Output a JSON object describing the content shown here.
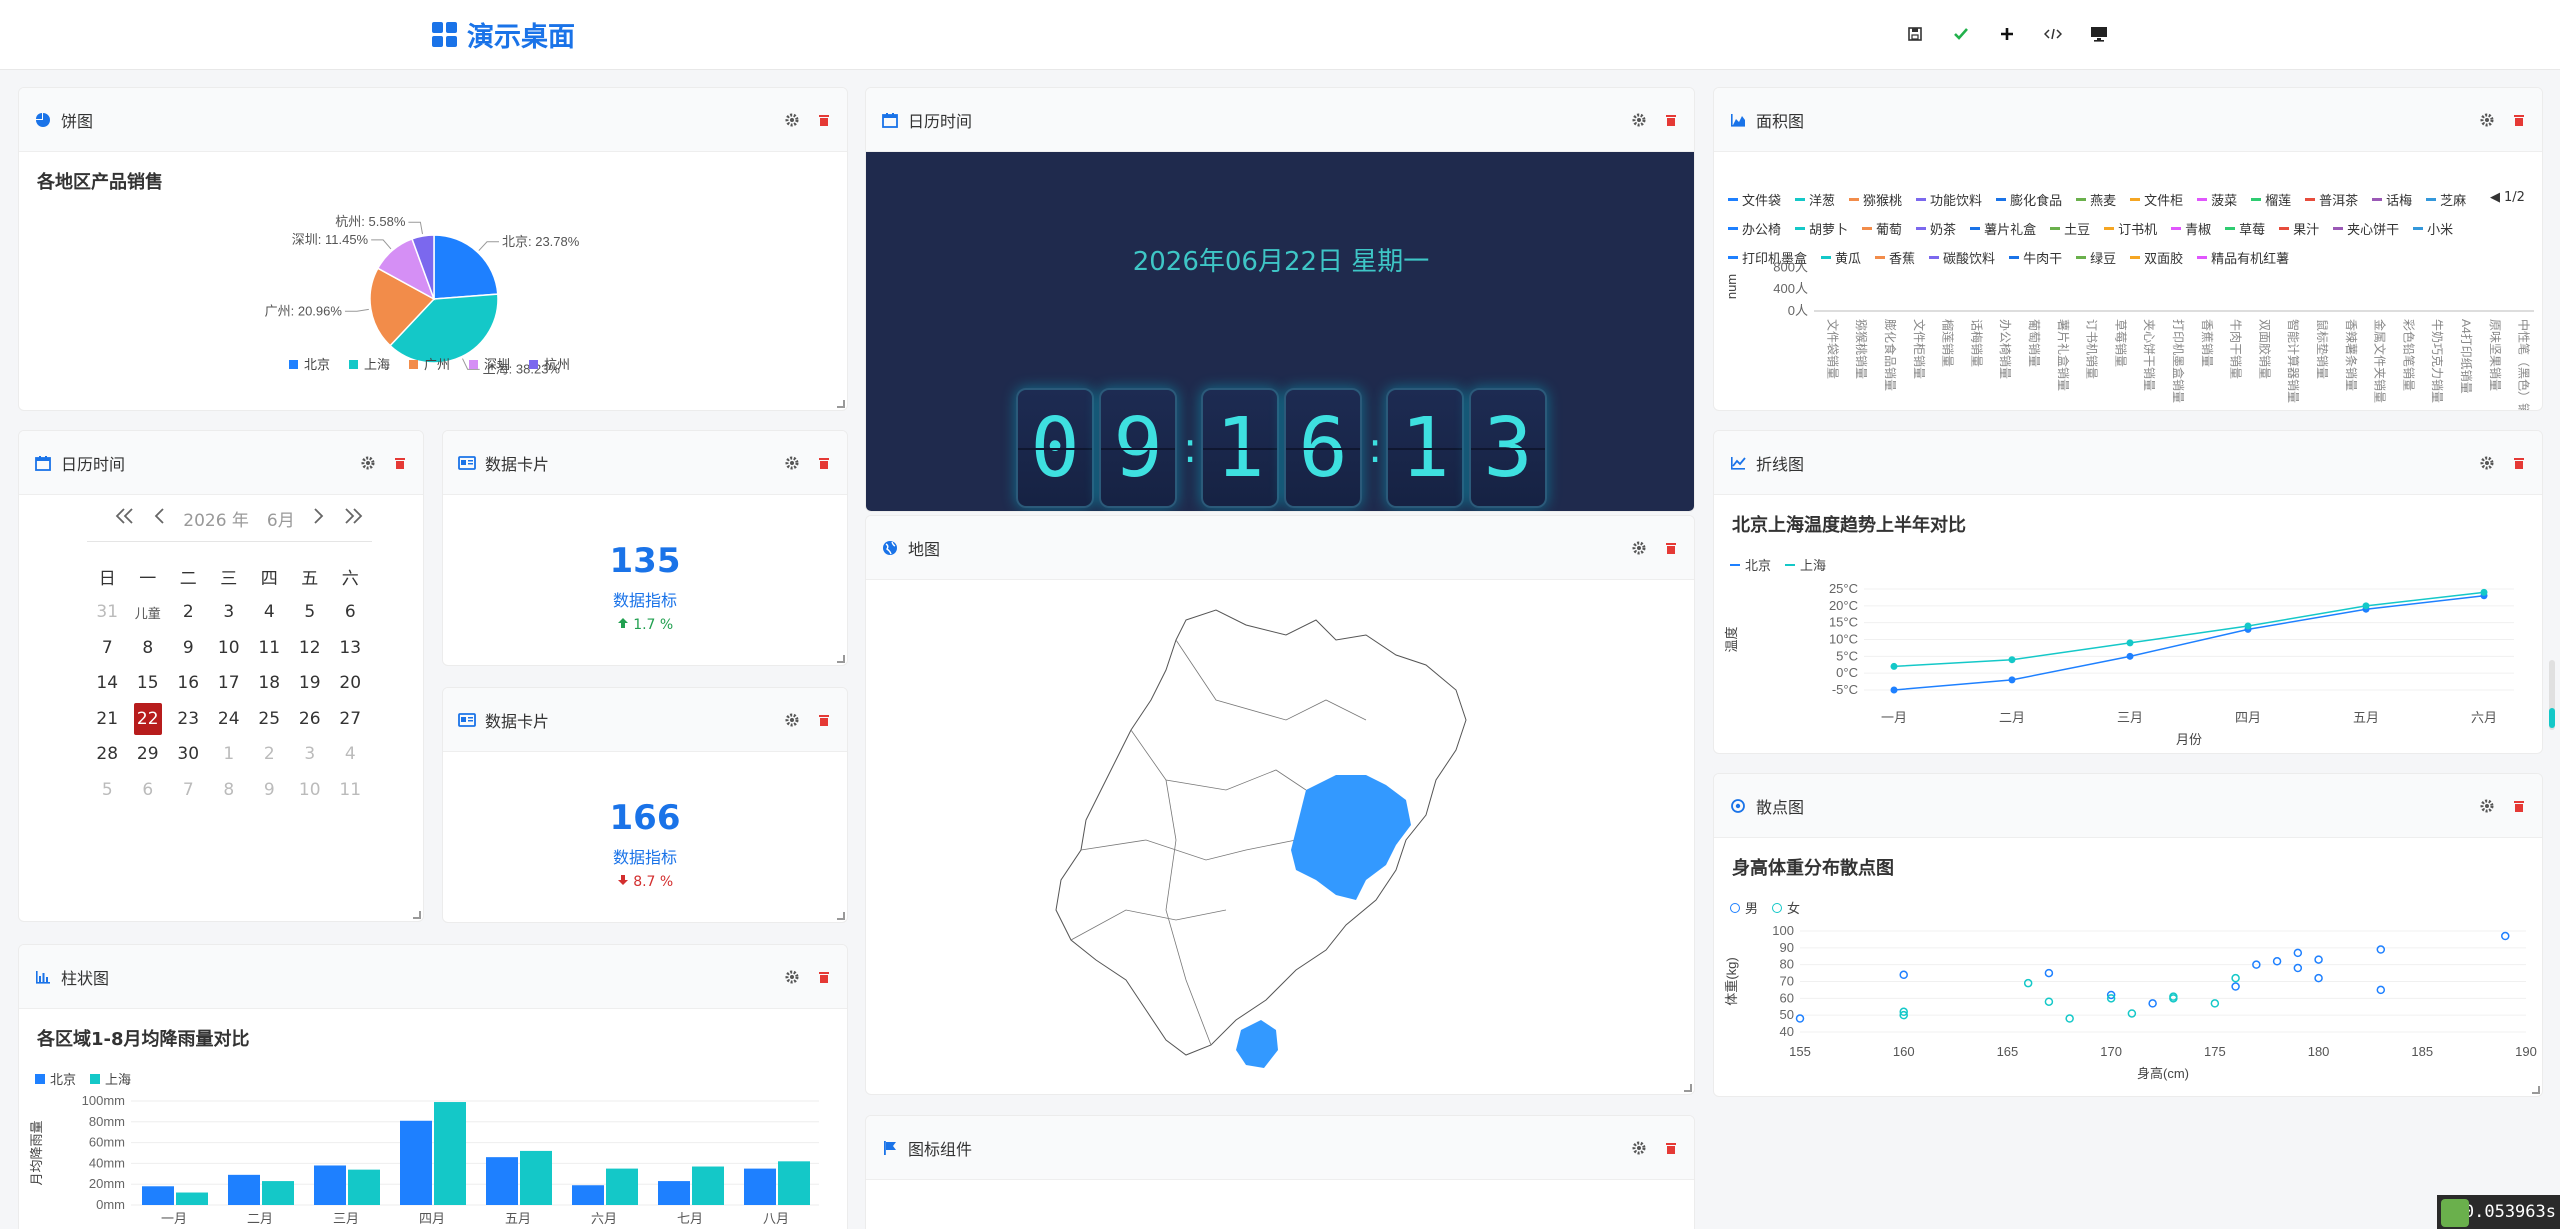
{
  "app": {
    "title": "演示桌面"
  },
  "toolbar": [
    "save-icon",
    "check-icon",
    "plus-icon",
    "code-icon",
    "monitor-icon"
  ],
  "colors": {
    "blue": "#1e80ff",
    "cyan": "#14c8c8",
    "orange": "#f28c4a",
    "purple": "#d58ff5",
    "violet": "#7b68ee",
    "accent": "#1a73e8"
  },
  "pie": {
    "panel_title": "饼图",
    "chart_data": {
      "type": "pie",
      "title": "各地区产品销售",
      "slices": [
        {
          "name": "北京",
          "value": 23.78,
          "label": "北京: 23.78%"
        },
        {
          "name": "上海",
          "value": 38.23,
          "label": "上海: 38.23%"
        },
        {
          "name": "广州",
          "value": 20.96,
          "label": "广州: 20.96%"
        },
        {
          "name": "深圳",
          "value": 11.45,
          "label": "深圳: 11.45%"
        },
        {
          "name": "杭州",
          "value": 5.58,
          "label": "杭州: 5.58%"
        }
      ],
      "legend": [
        "北京",
        "上海",
        "广州",
        "深圳",
        "杭州"
      ],
      "legend_position": "bottom"
    }
  },
  "calendar": {
    "panel_title": "日历时间",
    "year": "2026 年",
    "month": "6月",
    "weekdays": [
      "日",
      "一",
      "二",
      "三",
      "四",
      "五",
      "六"
    ],
    "days": [
      "31",
      "儿童",
      "2",
      "3",
      "4",
      "5",
      "6",
      "7",
      "8",
      "9",
      "10",
      "11",
      "12",
      "13",
      "14",
      "15",
      "16",
      "17",
      "18",
      "19",
      "20",
      "21",
      "22",
      "23",
      "24",
      "25",
      "26",
      "27",
      "28",
      "29",
      "30",
      "1",
      "2",
      "3",
      "4",
      "5",
      "6",
      "7",
      "8",
      "9",
      "10",
      "11"
    ],
    "selected_index": 22
  },
  "stat1": {
    "panel_title": "数据卡片",
    "value": "135",
    "label": "数据指标",
    "change": "1.7 %",
    "direction": "up"
  },
  "stat2": {
    "panel_title": "数据卡片",
    "value": "166",
    "label": "数据指标",
    "change": "8.7 %",
    "direction": "down"
  },
  "clock": {
    "panel_title": "日历时间",
    "date": "2026年06月22日 星期一",
    "digits": [
      "0",
      "9",
      "1",
      "6",
      "1",
      "3"
    ]
  },
  "map": {
    "panel_title": "地图"
  },
  "icons_panel": {
    "panel_title": "图标组件"
  },
  "area": {
    "panel_title": "面积图",
    "legend": [
      "文件袋",
      "洋葱",
      "猕猴桃",
      "功能饮料",
      "膨化食品",
      "燕麦",
      "文件柜",
      "菠菜",
      "榴莲",
      "普洱茶",
      "话梅",
      "芝麻",
      "办公椅",
      "胡萝卜",
      "葡萄",
      "奶茶",
      "薯片礼盒",
      "土豆",
      "订书机",
      "青椒",
      "草莓",
      "果汁",
      "夹心饼干",
      "小米",
      "打印机墨盒",
      "黄瓜",
      "香蕉",
      "碳酸饮料",
      "牛肉干",
      "绿豆",
      "双面胶",
      "精品有机红薯"
    ],
    "pager": "1/2",
    "chart_data": {
      "type": "area",
      "ylabel": "num",
      "yticks": [
        "0人",
        "400人",
        "800人"
      ],
      "ylim": [
        0,
        900
      ],
      "categories": [
        "文件袋销量",
        "猕猴桃销量",
        "膨化食品销量",
        "文件柜销量",
        "榴莲销量",
        "话梅销量",
        "办公椅销量",
        "葡萄销量",
        "薯片礼盒销量",
        "订书机销量",
        "草莓销量",
        "夹心饼干销量",
        "打印机墨盒销量",
        "香蕉销量",
        "牛肉干销量",
        "双面胶销量",
        "智能计算器销量",
        "鼠标垫销量",
        "香辣薯条销量",
        "金属文件夹销量",
        "彩色铅笔销量",
        "牛奶巧克力销量",
        "A4打印纸销量",
        "原味坚果销量",
        "中性笔（黑色）销量"
      ],
      "series_note": "sparse points"
    }
  },
  "line": {
    "panel_title": "折线图",
    "chart_data": {
      "type": "line",
      "title": "北京上海温度趋势上半年对比",
      "xlabel": "月份",
      "ylabel": "温度",
      "categories": [
        "一月",
        "二月",
        "三月",
        "四月",
        "五月",
        "六月"
      ],
      "ylim": [
        -5,
        25
      ],
      "yticks": [
        "-5°C",
        "0°C",
        "5°C",
        "10°C",
        "15°C",
        "20°C",
        "25°C"
      ],
      "series": [
        {
          "name": "北京",
          "values": [
            -5,
            -2,
            5,
            13,
            19,
            23
          ]
        },
        {
          "name": "上海",
          "values": [
            2,
            4,
            9,
            14,
            20,
            24
          ]
        }
      ]
    }
  },
  "scatter": {
    "panel_title": "散点图",
    "chart_data": {
      "type": "scatter",
      "title": "身高体重分布散点图",
      "xlabel": "身高(cm)",
      "ylabel": "体重(kg)",
      "xlim": [
        155,
        190
      ],
      "ylim": [
        40,
        100
      ],
      "xticks": [
        "155",
        "160",
        "165",
        "170",
        "175",
        "180",
        "185",
        "190"
      ],
      "yticks": [
        "40",
        "50",
        "60",
        "70",
        "80",
        "90",
        "100"
      ],
      "series": [
        {
          "name": "男",
          "points": [
            [
              155,
              48
            ],
            [
              160,
              74
            ],
            [
              167,
              75
            ],
            [
              170,
              62
            ],
            [
              172,
              57
            ],
            [
              176,
              67
            ],
            [
              177,
              80
            ],
            [
              178,
              82
            ],
            [
              179,
              87
            ],
            [
              180,
              83
            ],
            [
              183,
              89
            ],
            [
              189,
              97
            ],
            [
              179,
              78
            ],
            [
              180,
              72
            ],
            [
              183,
              65
            ]
          ]
        },
        {
          "name": "女",
          "points": [
            [
              160,
              52
            ],
            [
              160,
              50
            ],
            [
              166,
              69
            ],
            [
              167,
              58
            ],
            [
              168,
              48
            ],
            [
              170,
              60
            ],
            [
              171,
              51
            ],
            [
              173,
              60
            ],
            [
              173,
              61
            ],
            [
              175,
              57
            ],
            [
              176,
              72
            ]
          ]
        }
      ]
    }
  },
  "bar": {
    "panel_title": "柱状图",
    "chart_data": {
      "type": "bar",
      "title": "各区域1-8月均降雨量对比",
      "ylabel": "月均降雨量",
      "categories": [
        "一月",
        "二月",
        "三月",
        "四月",
        "五月",
        "六月",
        "七月",
        "八月"
      ],
      "ylim": [
        0,
        100
      ],
      "yticks": [
        "0mm",
        "20mm",
        "40mm",
        "60mm",
        "80mm",
        "100mm"
      ],
      "series": [
        {
          "name": "北京",
          "values": [
            18,
            29,
            38,
            81,
            46,
            19,
            23,
            35
          ]
        },
        {
          "name": "上海",
          "values": [
            12,
            23,
            34,
            99,
            52,
            35,
            37,
            42
          ]
        }
      ]
    }
  },
  "status": {
    "fps": "0.053963s"
  }
}
